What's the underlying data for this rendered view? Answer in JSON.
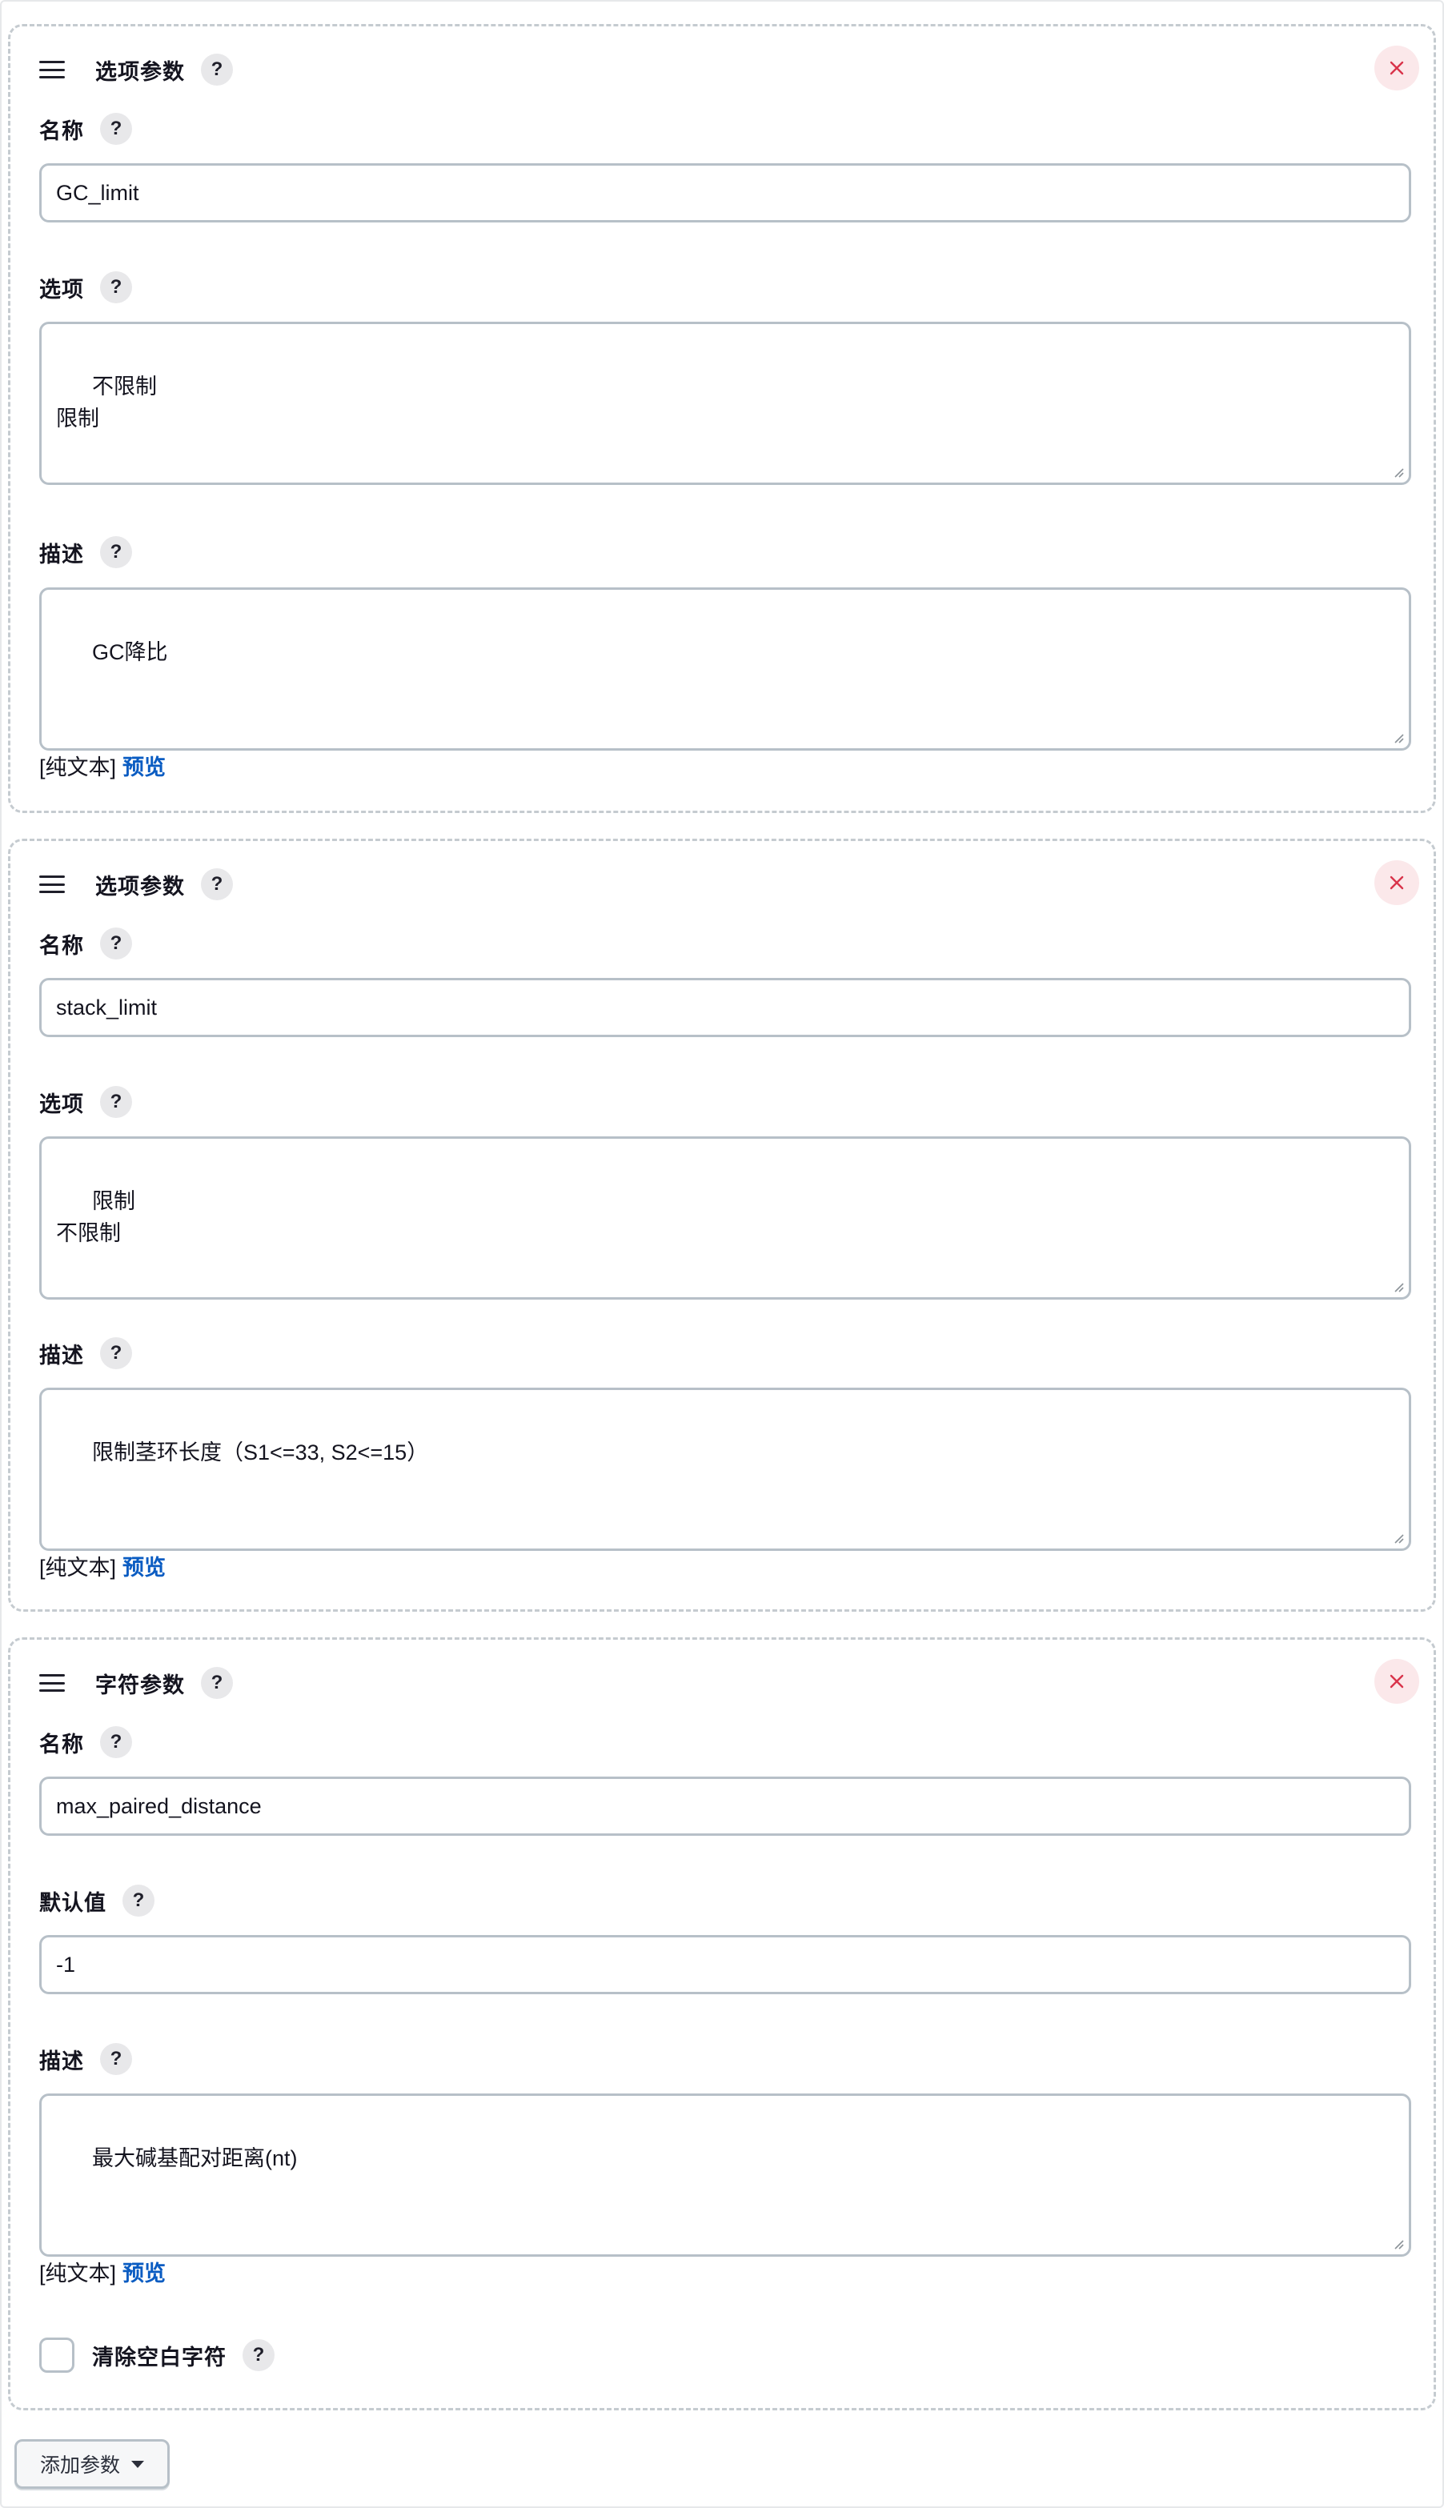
{
  "blocks": [
    {
      "type_label": "选项参数",
      "fields": {
        "name_label": "名称",
        "name_value": "GC_limit",
        "choices_label": "选项",
        "choices_value": "不限制\n限制",
        "description_label": "描述",
        "description_value": "GC降比"
      },
      "plain_text_label": "[纯文本]",
      "preview_label": "预览"
    },
    {
      "type_label": "选项参数",
      "fields": {
        "name_label": "名称",
        "name_value": "stack_limit",
        "choices_label": "选项",
        "choices_value": "限制\n不限制",
        "description_label": "描述",
        "description_value": "限制茎环长度（S1<=33, S2<=15）"
      },
      "plain_text_label": "[纯文本]",
      "preview_label": "预览"
    },
    {
      "type_label": "字符参数",
      "fields": {
        "name_label": "名称",
        "name_value": "max_paired_distance",
        "default_label": "默认值",
        "default_value": "-1",
        "description_label": "描述",
        "description_value": "最大碱基配对距离(nt)"
      },
      "plain_text_label": "[纯文本]",
      "preview_label": "预览",
      "trim_label": "清除空白字符",
      "trim_checked": false
    }
  ],
  "add_button_label": "添加参数",
  "help_symbol": "?",
  "icons": {
    "drag": "drag-handle-icon",
    "help": "help-icon",
    "close": "close-icon",
    "caret": "caret-down-icon"
  },
  "colors": {
    "link": "#0a5cc2",
    "close": "#d9344b",
    "close_bg": "#fbe8ea",
    "border": "#b7c0c8"
  }
}
